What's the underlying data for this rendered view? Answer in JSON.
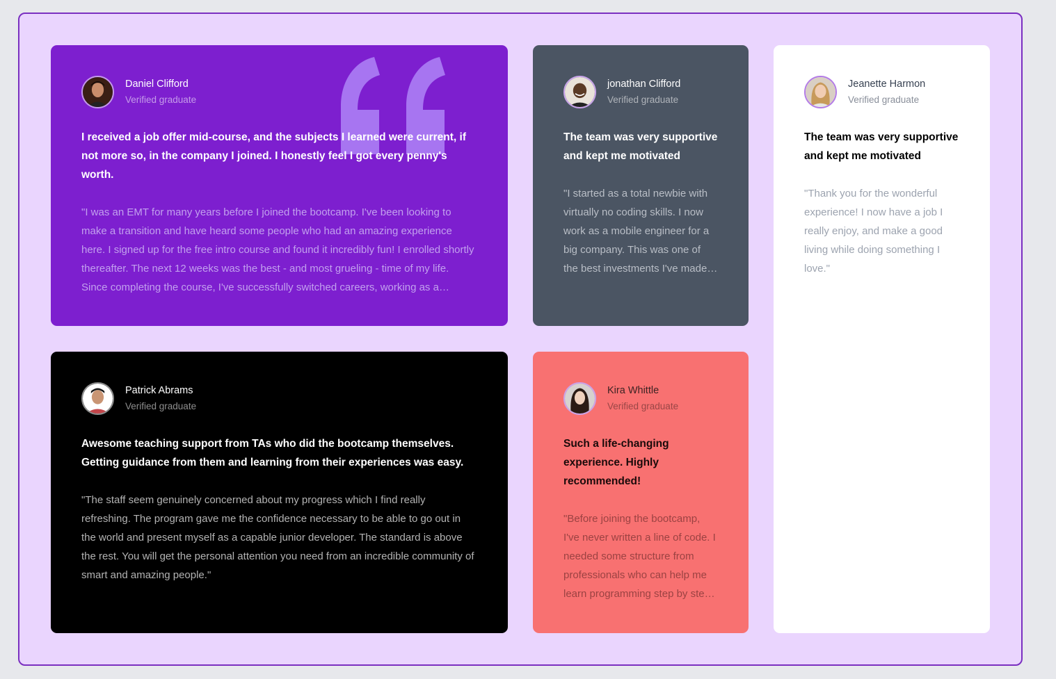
{
  "colors": {
    "page_bg": "#e7e8ec",
    "frame_bg": "#ead5fe",
    "frame_border": "#7a2fc0",
    "purple": "#7d1fcf",
    "slate": "#4b5563",
    "white": "#ffffff",
    "black": "#000000",
    "coral": "#f87171"
  },
  "testimonials": [
    {
      "name": "Daniel Clifford",
      "role": "Verified graduate",
      "avatar_icon": "avatar-daniel",
      "headline": "I received a job offer mid-course, and the subjects I learned were current, if not more so, in the company I joined. I honestly feel I got every penny's worth.",
      "body": "\"I was an EMT for many years before I joined the bootcamp. I've been looking to make a transition and have heard some people who had an amazing experience here. I signed up for the free intro course and found it incredibly fun! I enrolled shortly thereafter. The next 12 weeks was the best - and most grueling - time of my life. Since completing the course, I've successfully switched careers, working as a Software Engineer at a VR startup.\""
    },
    {
      "name": "jonathan Clifford",
      "role": "Verified graduate",
      "avatar_icon": "avatar-jonathan",
      "headline": "The team was very supportive and kept me motivated",
      "body": "\"I started as a total newbie with virtually no coding skills. I now work as a mobile engineer for a big company. This was one of the best investments I've made in myself.\""
    },
    {
      "name": "Jeanette Harmon",
      "role": "Verified graduate",
      "avatar_icon": "avatar-jeanette",
      "headline": "The team was very supportive and kept me motivated",
      "body": "\"Thank you for the wonderful experience! I now have a job I really enjoy, and make a good living while doing something I love.\""
    },
    {
      "name": "Patrick Abrams",
      "role": "Verified graduate",
      "avatar_icon": "avatar-patrick",
      "headline": "Awesome teaching support from TAs who did the bootcamp themselves. Getting guidance from them and learning from their experiences was easy.",
      "body": "\"The staff seem genuinely concerned about my progress which I find really refreshing. The program gave me the confidence necessary to be able to go out in the world and present myself as a capable junior developer. The standard is above the rest. You will get the personal attention you need from an incredible community of smart and amazing people.\""
    },
    {
      "name": "Kira Whittle",
      "role": "Verified graduate",
      "avatar_icon": "avatar-kira",
      "headline": "Such a life-changing experience. Highly recommended!",
      "body": "\"Before joining the bootcamp, I've never written a line of code. I needed some structure from professionals who can help me learn programming step by step. I was encouraged to enroll by a former student of theirs who can only say wonderful things about the program.\""
    }
  ]
}
